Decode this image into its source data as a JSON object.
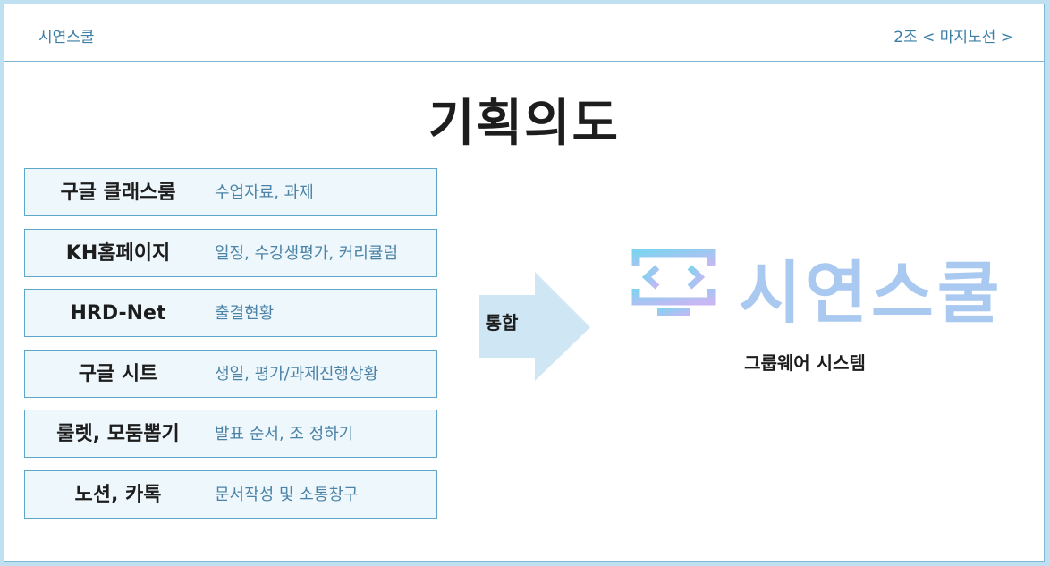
{
  "header": {
    "brand": "시연스쿨",
    "team": "2조 < 마지노선 >"
  },
  "title": "기획의도",
  "items": [
    {
      "name": "구글 클래스룸",
      "desc": "수업자료, 과제"
    },
    {
      "name": "KH홈페이지",
      "desc": "일정, 수강생평가, 커리큘럼"
    },
    {
      "name": "HRD-Net",
      "desc": "출결현황"
    },
    {
      "name": "구글 시트",
      "desc": "생일, 평가/과제진행상황"
    },
    {
      "name": "룰렛, 모둠뽑기",
      "desc": "발표 순서, 조 정하기"
    },
    {
      "name": "노션, 카톡",
      "desc": "문서작성 및 소통창구"
    }
  ],
  "arrow_label": "통합",
  "logo_text": "시연스쿨",
  "subtitle": "그룹웨어 시스템",
  "colors": {
    "accent": "#5ea7cb",
    "row_bg": "#eef7fc",
    "logo_start": "#7fd3f0",
    "logo_end": "#c8b7f3"
  }
}
